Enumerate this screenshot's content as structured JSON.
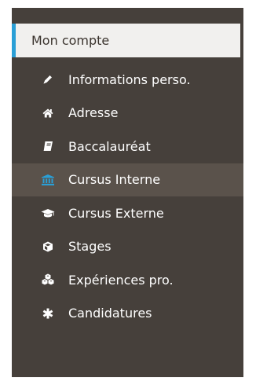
{
  "header": {
    "title": "Mon compte"
  },
  "colors": {
    "panel_bg": "#46403b",
    "header_bg": "#f1f0ee",
    "accent": "#2a9fd6",
    "active_bg": "#5a524b",
    "text": "#ffffff"
  },
  "menu": {
    "items": [
      {
        "label": "Informations perso.",
        "icon": "pencil-icon"
      },
      {
        "label": "Adresse",
        "icon": "home-icon"
      },
      {
        "label": "Baccalauréat",
        "icon": "book-icon"
      },
      {
        "label": "Cursus Interne",
        "icon": "institution-icon",
        "active": true
      },
      {
        "label": "Cursus Externe",
        "icon": "graduation-cap-icon"
      },
      {
        "label": "Stages",
        "icon": "cube-icon"
      },
      {
        "label": "Expériences pro.",
        "icon": "cubes-icon"
      },
      {
        "label": "Candidatures",
        "icon": "asterisk-icon"
      }
    ]
  }
}
